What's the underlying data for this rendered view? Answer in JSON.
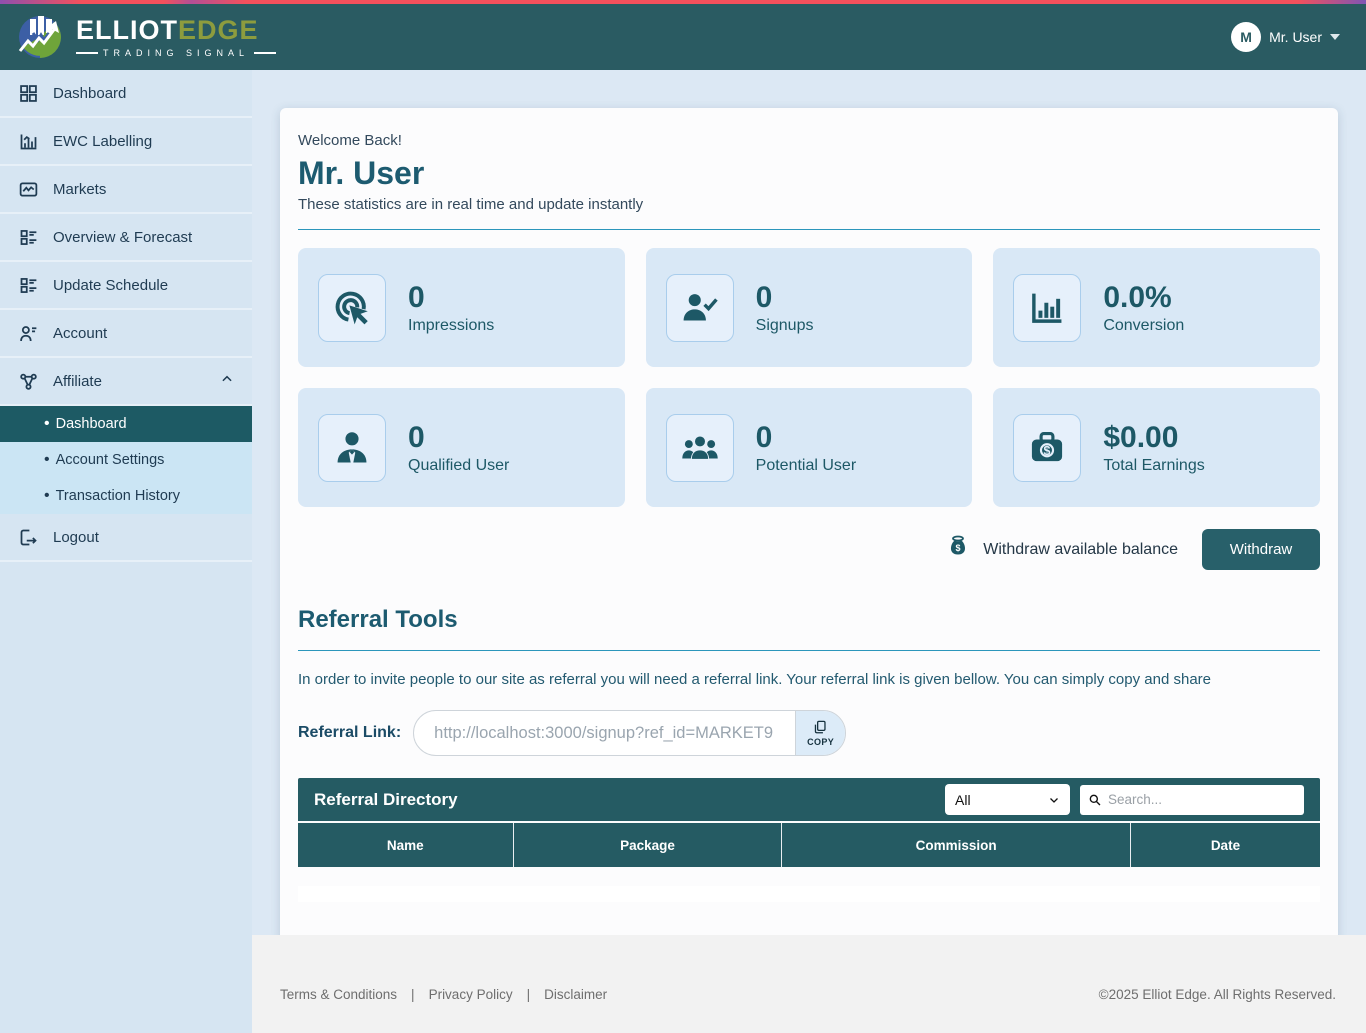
{
  "brand": {
    "name_primary": "ELLIOT",
    "name_secondary": "EDGE",
    "tagline": "TRADING SIGNAL"
  },
  "header": {
    "avatar_initial": "M",
    "user_name": "Mr. User"
  },
  "sidebar": {
    "items": [
      {
        "label": "Dashboard"
      },
      {
        "label": "EWC Labelling"
      },
      {
        "label": "Markets"
      },
      {
        "label": "Overview & Forecast"
      },
      {
        "label": "Update Schedule"
      },
      {
        "label": "Account"
      },
      {
        "label": "Affiliate"
      }
    ],
    "affiliate_submenu": [
      {
        "label": "Dashboard",
        "active": true
      },
      {
        "label": "Account Settings",
        "active": false
      },
      {
        "label": "Transaction History",
        "active": false
      }
    ],
    "bullet": "•",
    "logout_label": "Logout"
  },
  "main": {
    "welcome": "Welcome Back!",
    "user_name": "Mr. User",
    "subtitle": "These statistics are in real time and update instantly",
    "stats": [
      {
        "value": "0",
        "label": "Impressions",
        "icon": "click-icon"
      },
      {
        "value": "0",
        "label": "Signups",
        "icon": "person-check-icon"
      },
      {
        "value": "0.0%",
        "label": "Conversion",
        "icon": "bar-chart-icon"
      },
      {
        "value": "0",
        "label": "Qualified User",
        "icon": "person-icon"
      },
      {
        "value": "0",
        "label": "Potential User",
        "icon": "group-icon"
      },
      {
        "value": "$0.00",
        "label": "Total Earnings",
        "icon": "briefcase-dollar-icon"
      }
    ],
    "withdraw": {
      "text": "Withdraw available balance",
      "button_label": "Withdraw"
    },
    "referral_tools": {
      "title": "Referral Tools",
      "description": "In order to invite people to our site as referral you will need a referral link. Your referral link is given bellow. You can simply copy and share",
      "link_label": "Referral Link:",
      "link_placeholder": "http://localhost:3000/signup?ref_id=MARKET9",
      "copy_label": "COPY"
    },
    "directory": {
      "title": "Referral Directory",
      "filter_selected": "All",
      "search_placeholder": "Search...",
      "columns": [
        "Name",
        "Package",
        "Commission",
        "Date"
      ],
      "rows": []
    }
  },
  "footer": {
    "links": [
      "Terms & Conditions",
      "Privacy Policy",
      "Disclaimer"
    ],
    "separator": "|",
    "copyright": "©2025 Elliot Edge. All Rights Reserved."
  },
  "colors": {
    "header_teal": "#2a5b62",
    "accent_teal": "#1d5866",
    "directory_teal": "#255b63",
    "active_item_teal": "#1d5a64",
    "sidebar_bg": "#d6e5f2",
    "stat_card_bg": "#d9e8f6",
    "divider_blue": "#2b96bb",
    "top_loader_red": "#f4505c",
    "brand_secondary_green": "#8d9c3e"
  }
}
